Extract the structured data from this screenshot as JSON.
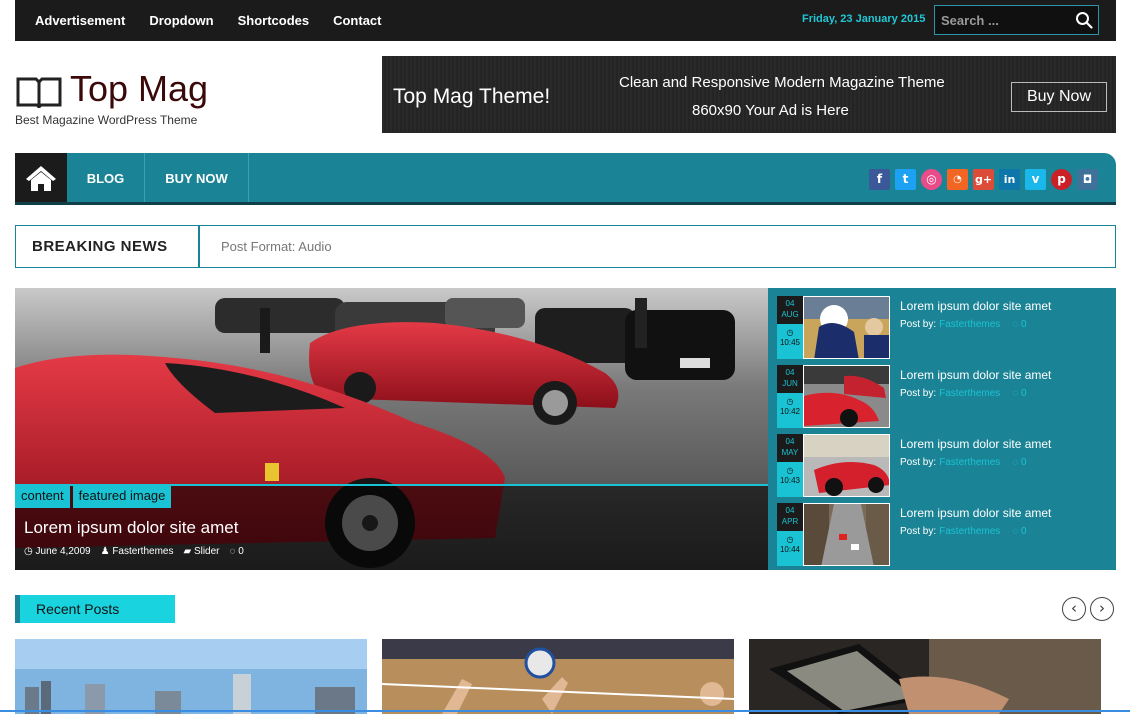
{
  "topbar": {
    "nav": [
      "Advertisement",
      "Dropdown",
      "Shortcodes",
      "Contact"
    ],
    "date": "Friday, 23 January 2015",
    "search_placeholder": "Search ..."
  },
  "header": {
    "title": "Top Mag",
    "tagline": "Best Magazine WordPress Theme"
  },
  "ad": {
    "title": "Top Mag Theme!",
    "line1": "Clean and Responsive Modern Magazine Theme",
    "line2": "860x90 Your Ad is Here",
    "button": "Buy Now"
  },
  "mainnav": {
    "items": [
      "BLOG",
      "BUY NOW"
    ],
    "social": [
      "facebook-icon",
      "twitter-icon",
      "dribbble-icon",
      "rss-icon",
      "google-plus-icon",
      "linkedin-icon",
      "vimeo-icon",
      "pinterest-icon",
      "instagram-icon"
    ]
  },
  "breaking": {
    "label": "BREAKING NEWS",
    "text": "Post Format: Audio"
  },
  "slider": {
    "tags": [
      "content",
      "featured image"
    ],
    "title": "Lorem ipsum dolor site amet",
    "date": "June 4,2009",
    "author": "Fasterthemes",
    "category": "Slider",
    "comments": "0"
  },
  "side_posts": [
    {
      "day": "04",
      "month": "AUG",
      "time": "10:45",
      "title": "Lorem ipsum dolor site amet",
      "by": "Post by:",
      "author": "Fasterthemes",
      "comments": "0"
    },
    {
      "day": "04",
      "month": "JUN",
      "time": "10:42",
      "title": "Lorem ipsum dolor site amet",
      "by": "Post by:",
      "author": "Fasterthemes",
      "comments": "0"
    },
    {
      "day": "04",
      "month": "MAY",
      "time": "10:43",
      "title": "Lorem ipsum dolor site amet",
      "by": "Post by:",
      "author": "Fasterthemes",
      "comments": "0"
    },
    {
      "day": "04",
      "month": "APR",
      "time": "10:44",
      "title": "Lorem ipsum dolor site amet",
      "by": "Post by:",
      "author": "Fasterthemes",
      "comments": "0"
    }
  ],
  "recent": {
    "label": "Recent Posts",
    "prev": "‹",
    "next": "›"
  },
  "colors": {
    "accent": "#1b8396",
    "cyan": "#19c3d3",
    "dark": "#1b1b1b"
  }
}
